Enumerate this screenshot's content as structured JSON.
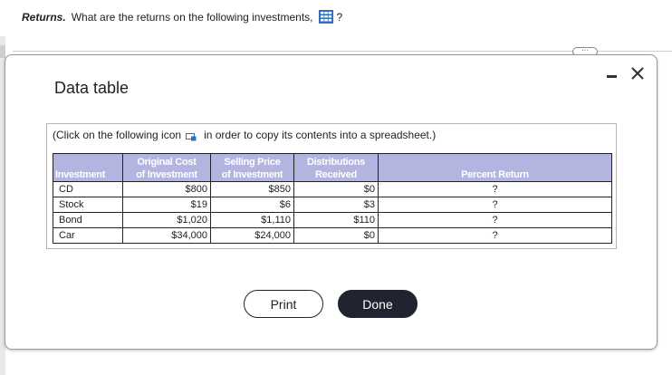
{
  "question": {
    "lead": "Returns.",
    "text": "What are the returns on the following investments,",
    "icon": "grid-table-icon",
    "suffix": "?"
  },
  "dialog": {
    "title": "Data table",
    "minimize_icon": "minimize-icon",
    "close_icon": "close-icon",
    "instruction_before": "(Click on the following icon",
    "instruction_after": "in order to copy its contents into a spreadsheet.)",
    "copy_icon": "copy-icon"
  },
  "table": {
    "headers": {
      "investment": "Investment",
      "original_cost_1": "Original Cost",
      "original_cost_2": "of Investment",
      "selling_price_1": "Selling Price",
      "selling_price_2": "of Investment",
      "distributions_1": "Distributions",
      "distributions_2": "Received",
      "percent_return": "Percent Return"
    },
    "rows": [
      {
        "investment": "CD",
        "original_cost": "$800",
        "selling_price": "$850",
        "distributions": "$0",
        "percent_return": "?"
      },
      {
        "investment": "Stock",
        "original_cost": "$19",
        "selling_price": "$6",
        "distributions": "$3",
        "percent_return": "?"
      },
      {
        "investment": "Bond",
        "original_cost": "$1,020",
        "selling_price": "$1,110",
        "distributions": "$110",
        "percent_return": "?"
      },
      {
        "investment": "Car",
        "original_cost": "$34,000",
        "selling_price": "$24,000",
        "distributions": "$0",
        "percent_return": "?"
      }
    ]
  },
  "buttons": {
    "print": "Print",
    "done": "Done"
  },
  "colors": {
    "header_bg": "#b4b4e0",
    "done_bg": "#1f2430",
    "icon_blue": "#2f6fbf"
  }
}
